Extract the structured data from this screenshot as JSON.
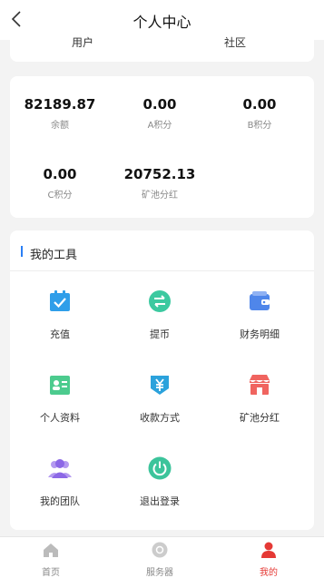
{
  "header": {
    "title": "个人中心"
  },
  "top_card": {
    "left_label": "用户",
    "right_label": "社区"
  },
  "stats": [
    {
      "value": "82189.87",
      "label": "余额"
    },
    {
      "value": "0.00",
      "label": "A积分"
    },
    {
      "value": "0.00",
      "label": "B积分"
    },
    {
      "value": "0.00",
      "label": "C积分"
    },
    {
      "value": "20752.13",
      "label": "矿池分红"
    }
  ],
  "tools": {
    "title": "我的工具",
    "items": [
      {
        "label": "充值",
        "icon": "recharge-icon",
        "color": "#2f9ee9"
      },
      {
        "label": "提币",
        "icon": "exchange-icon",
        "color": "#3cc9a0"
      },
      {
        "label": "财务明细",
        "icon": "wallet-icon",
        "color": "#4f86ea"
      },
      {
        "label": "个人资料",
        "icon": "id-card-icon",
        "color": "#4ccb8e"
      },
      {
        "label": "收款方式",
        "icon": "yuan-shield-icon",
        "color": "#2ba2dc"
      },
      {
        "label": "矿池分红",
        "icon": "shop-icon",
        "color": "#f0645f"
      },
      {
        "label": "我的团队",
        "icon": "team-icon",
        "color": "#8c68e6"
      },
      {
        "label": "退出登录",
        "icon": "power-icon",
        "color": "#3cc49b"
      }
    ]
  },
  "tabbar": {
    "items": [
      {
        "label": "首页",
        "icon": "home-icon"
      },
      {
        "label": "服务器",
        "icon": "server-icon"
      },
      {
        "label": "我的",
        "icon": "user-icon",
        "active_color": "#e53935"
      }
    ]
  }
}
